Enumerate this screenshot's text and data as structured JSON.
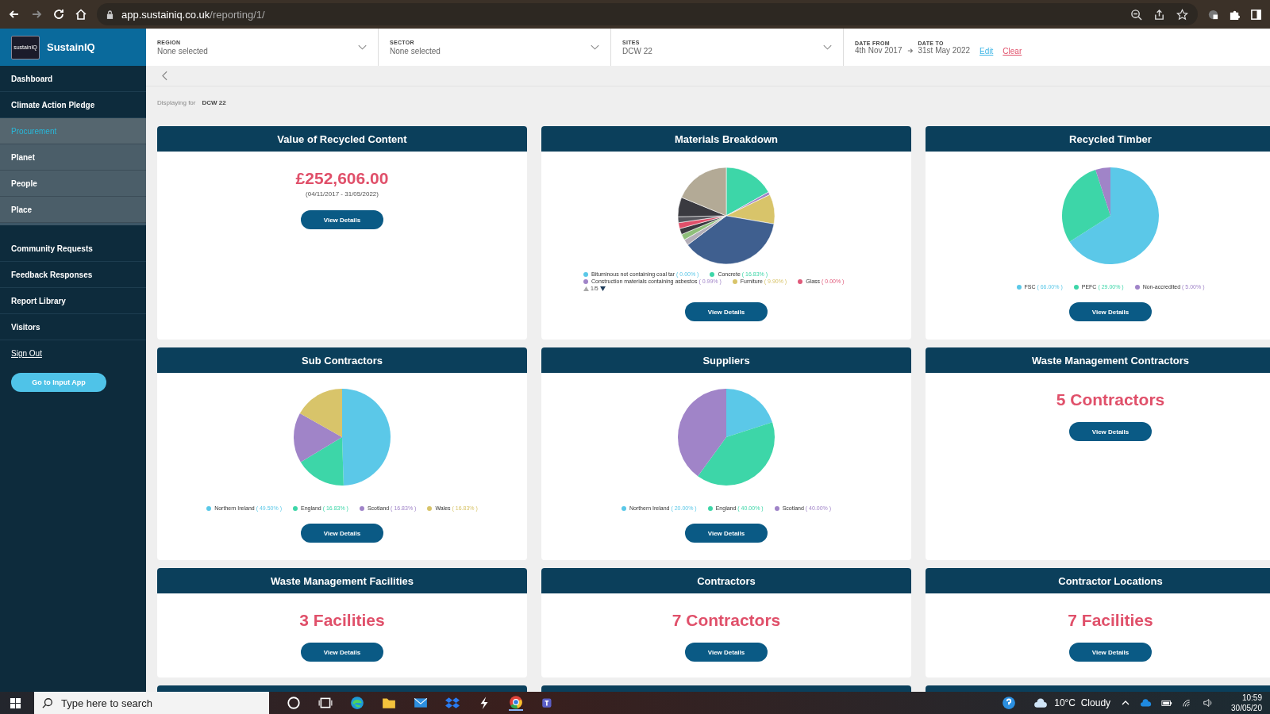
{
  "browser": {
    "url_host": "app.sustainiq.co.uk",
    "url_path": "/reporting/1/"
  },
  "sidebar": {
    "brand": "SustainIQ",
    "logo_text": "sustainIQ",
    "items": [
      {
        "label": "Dashboard",
        "kind": "primary",
        "selected": false
      },
      {
        "label": "Climate Action Pledge",
        "kind": "primary",
        "selected": false
      },
      {
        "label": "Procurement",
        "kind": "secondary",
        "selected": true
      },
      {
        "label": "Planet",
        "kind": "secondary",
        "selected": false
      },
      {
        "label": "People",
        "kind": "secondary",
        "selected": false
      },
      {
        "label": "Place",
        "kind": "secondary",
        "selected": false
      },
      {
        "label": "Community Requests",
        "kind": "primary",
        "selected": false
      },
      {
        "label": "Feedback Responses",
        "kind": "primary",
        "selected": false
      },
      {
        "label": "Report Library",
        "kind": "primary",
        "selected": false
      },
      {
        "label": "Visitors",
        "kind": "primary",
        "selected": false
      },
      {
        "label": "Sign Out",
        "kind": "link",
        "selected": false
      }
    ],
    "button": "Go to Input App"
  },
  "filters": [
    {
      "label": "REGION",
      "value": "None selected"
    },
    {
      "label": "SECTOR",
      "value": "None selected"
    },
    {
      "label": "SITES",
      "value": "DCW 22"
    }
  ],
  "date_filter": {
    "from_label": "DATE FROM",
    "from": "4th Nov 2017",
    "to_label": "DATE TO",
    "to": "31st May 2022",
    "edit": "Edit",
    "clear": "Clear"
  },
  "displaying": {
    "label": "Displaying for",
    "value": "DCW 22"
  },
  "cards": [
    {
      "title": "Value of Recycled Content",
      "kind": "amount",
      "value": "£252,606.00",
      "subtitle": "(04/11/2017 - 31/05/2022)",
      "button": "View Details"
    },
    {
      "title": "Materials Breakdown",
      "kind": "pie_picture",
      "legend": [
        {
          "label": "Bituminous not containing coal tar",
          "percent": "( 0.00% )",
          "color": "#5bc8e8"
        },
        {
          "label": "Concrete",
          "percent": "( 16.83% )",
          "color": "#3dd6a8"
        },
        {
          "label": "Construction materials containing asbestos",
          "percent": "( 0.99% )",
          "color": "#a084c8"
        },
        {
          "label": "Furniture",
          "percent": "( 9.90% )",
          "color": "#d8c46a"
        },
        {
          "label": "Glass",
          "percent": "( 0.00% )",
          "color": "#e05a7a"
        }
      ],
      "pager": "1/5",
      "button": "View Details"
    },
    {
      "title": "Recycled Timber",
      "kind": "pie",
      "chart_data": {
        "type": "pie",
        "categories": [
          "FSC",
          "PEFC",
          "Non-accredited"
        ],
        "values": [
          66,
          29,
          5
        ]
      },
      "legend": [
        {
          "percent": "( 66.00% )",
          "color": "#5bc8e8"
        },
        {
          "percent": "( 29.00% )",
          "color": "#3dd6a8"
        },
        {
          "percent": "( 5.00% )",
          "color": "#a084c8"
        }
      ],
      "button": "View Details"
    },
    {
      "title": "Sub Contractors",
      "kind": "pie",
      "chart_data": {
        "type": "pie",
        "categories": [
          "Northern Ireland",
          "England",
          "Scotland",
          "Wales"
        ],
        "values": [
          49.5,
          16.83,
          16.83,
          16.83
        ]
      },
      "legend": [
        {
          "percent": "( 49.50% )",
          "color": "#5bc8e8"
        },
        {
          "percent": "( 16.83% )",
          "color": "#3dd6a8"
        },
        {
          "percent": "( 16.83% )",
          "color": "#a084c8"
        },
        {
          "percent": "( 16.83% )",
          "color": "#d8c46a"
        }
      ],
      "button": "View Details"
    },
    {
      "title": "Suppliers",
      "kind": "pie",
      "chart_data": {
        "type": "pie",
        "categories": [
          "Northern Ireland",
          "England",
          "Scotland"
        ],
        "values": [
          20,
          40,
          40
        ]
      },
      "legend": [
        {
          "percent": "( 20.00% )",
          "color": "#5bc8e8"
        },
        {
          "percent": "( 40.00% )",
          "color": "#3dd6a8"
        },
        {
          "percent": "( 40.00% )",
          "color": "#a084c8"
        }
      ],
      "button": "View Details"
    },
    {
      "title": "Waste Management Contractors",
      "kind": "count",
      "value": "5 Contractors",
      "button": "View Details"
    },
    {
      "title": "Waste Management Facilities",
      "kind": "count",
      "value": "3 Facilities",
      "button": "View Details"
    },
    {
      "title": "Contractors",
      "kind": "count",
      "value": "7 Contractors",
      "button": "View Details"
    },
    {
      "title": "Contractor Locations",
      "kind": "count",
      "value": "7 Facilities",
      "button": "View Details"
    }
  ],
  "taskbar": {
    "search_placeholder": "Type here to search",
    "weather": "10°C  Cloudy",
    "time": "10:59",
    "date": "30/05/20"
  }
}
